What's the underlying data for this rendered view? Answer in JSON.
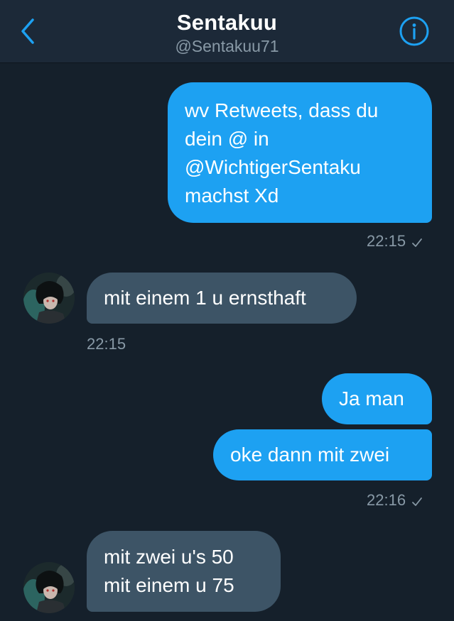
{
  "header": {
    "back_icon": "chevron-left-icon",
    "title": "Sentakuu",
    "handle": "@Sentakuu71",
    "info_icon": "info-circle-icon"
  },
  "colors": {
    "background": "#15202b",
    "header": "#1c2938",
    "outgoing_bubble": "#1da1f2",
    "incoming_bubble": "#3d5466",
    "meta_text": "#8899a6",
    "accent": "#1da1f2"
  },
  "messages": [
    {
      "direction": "outgoing",
      "text": "wv Retweets, dass du\ndein @ in\n@WichtigerSentaku\nmachst Xd",
      "time": "22:15",
      "status_icon": "checkmark-icon"
    },
    {
      "direction": "incoming",
      "text": "mit einem 1 u ernsthaft",
      "time": "22:15",
      "avatar_icon": "avatar"
    },
    {
      "direction": "outgoing",
      "text": "Ja man"
    },
    {
      "direction": "outgoing",
      "text": "oke dann mit zwei",
      "time": "22:16",
      "status_icon": "checkmark-icon"
    },
    {
      "direction": "incoming",
      "text": "mit zwei u's 50\nmit einem u 75",
      "avatar_icon": "avatar"
    }
  ]
}
